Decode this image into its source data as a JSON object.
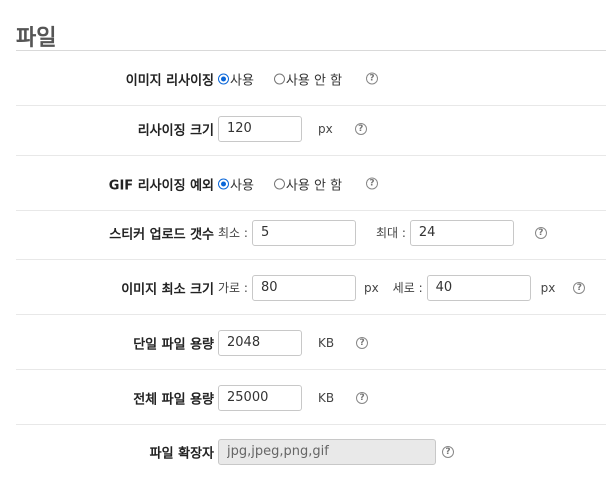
{
  "section": {
    "title": "파일"
  },
  "rows": {
    "image_resize": {
      "label": "이미지 리사이징",
      "options": [
        "사용",
        "사용 안 함"
      ],
      "selected": "사용"
    },
    "resize_size": {
      "label": "리사이징 크기",
      "value": "120",
      "unit": "px"
    },
    "gif_resize_exception": {
      "label": "GIF 리사이징 예외",
      "options": [
        "사용",
        "사용 안 함"
      ],
      "selected": "사용"
    },
    "sticker_upload_count": {
      "label": "스티커 업로드 갯수",
      "min_label": "최소 :",
      "min_value": "5",
      "max_label": "최대 :",
      "max_value": "24"
    },
    "image_min_size": {
      "label": "이미지 최소 크기",
      "width_label": "가로 :",
      "width_value": "80",
      "height_label": "세로 :",
      "height_value": "40",
      "unit": "px"
    },
    "single_file_size": {
      "label": "단일 파일 용량",
      "value": "2048",
      "unit": "KB"
    },
    "total_file_size": {
      "label": "전체 파일 용량",
      "value": "25000",
      "unit": "KB"
    },
    "file_extensions": {
      "label": "파일 확장자",
      "value": "jpg,jpeg,png,gif"
    }
  },
  "help_glyph": "?",
  "colors": {
    "radio_accent": "#0a66d8",
    "readonly_bg": "#e9e9e9"
  }
}
